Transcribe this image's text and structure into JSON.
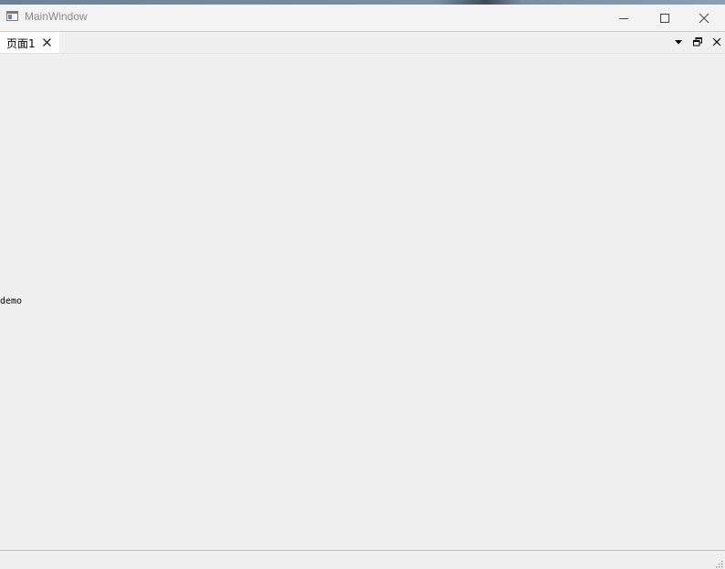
{
  "window": {
    "title": "MainWindow",
    "minimize_icon": "minimize-icon",
    "maximize_icon": "maximize-icon",
    "close_icon": "close-icon"
  },
  "tabs": [
    {
      "label": "页面1",
      "active": true
    }
  ],
  "tab_controls": {
    "menu_icon": "dropdown-arrow-icon",
    "float_icon": "restore-icon",
    "close_icon": "close-icon"
  },
  "content": {
    "label": "demo"
  },
  "colors": {
    "background": "#f0f0f0",
    "titlebar": "#f3f3f3",
    "active_tab": "#ffffff",
    "title_text": "#8a8a8a"
  }
}
